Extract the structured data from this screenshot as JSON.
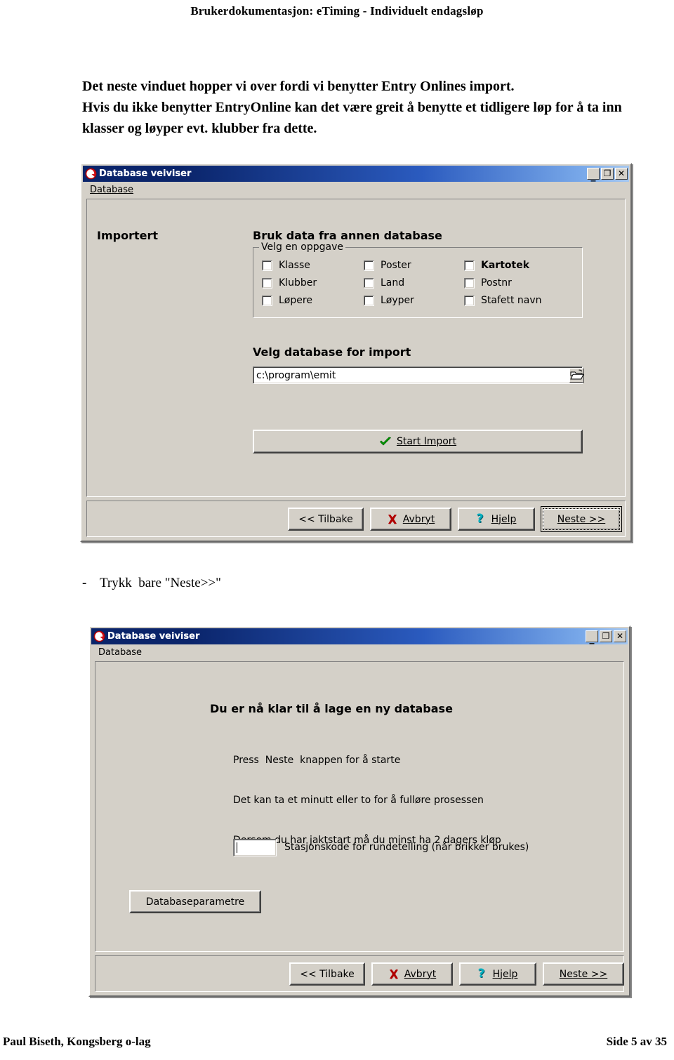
{
  "document": {
    "header": "Brukerdokumentasjon: eTiming - Individuelt endagsløp",
    "paragraph_line1": "Det neste vinduet hopper vi over fordi vi benytter Entry Onlines import.",
    "paragraph_line2": "Hvis du ikke benytter EntryOnline kan det være greit å benytte et tidligere løp for å ta inn",
    "paragraph_line3": "klasser og løyper evt. klubber fra dette.",
    "note": "-    Trykk  bare \"Neste>>\"",
    "footer_left": "Paul Biseth, Kongsberg o-lag",
    "footer_right": "Side 5 av 35"
  },
  "dialog1": {
    "title": "Database veiviser",
    "menu": {
      "database": "Database"
    },
    "window_buttons": {
      "minimize": "_",
      "maximize": "❐",
      "close": "✕"
    },
    "left_label": "Importert",
    "section_title": "Bruk data fra annen database",
    "groupbox_title": "Velg en oppgave",
    "checkboxes": [
      {
        "label": "Klasse",
        "checked": false,
        "bold": false
      },
      {
        "label": "Klubber",
        "checked": false,
        "bold": false
      },
      {
        "label": "Løpere",
        "checked": false,
        "bold": false
      },
      {
        "label": "Poster",
        "checked": false,
        "bold": false
      },
      {
        "label": "Land",
        "checked": false,
        "bold": false
      },
      {
        "label": "Løyper",
        "checked": false,
        "bold": false
      },
      {
        "label": "Kartotek",
        "checked": false,
        "bold": true
      },
      {
        "label": "Postnr",
        "checked": false,
        "bold": false
      },
      {
        "label": "Stafett navn",
        "checked": false,
        "bold": false
      }
    ],
    "db_label": "Velg database for import",
    "db_path_value": "c:\\program\\emit",
    "browse_icon": "folder-open-icon",
    "start_import_label": "Start Import",
    "start_import_icon": "green-check-icon",
    "buttons": {
      "back": "<< Tilbake",
      "cancel": "Avbryt",
      "help": "Hjelp",
      "next": "Neste >>"
    }
  },
  "dialog2": {
    "title": "Database veiviser",
    "menu": {
      "database": "Database"
    },
    "window_buttons": {
      "minimize": "_",
      "maximize": "❐",
      "close": "✕"
    },
    "heading": "Du er nå klar til å lage en ny database",
    "info_line1": "Press  Neste  knappen for å starte",
    "info_line2": "Det kan ta et minutt eller to for å fulløre prosessen",
    "info_line3": "Dersom du har jaktstart må du minst ha 2 dagers kløp",
    "station_code_value": "",
    "station_code_label": "Stasjonskode for rundetelling (når brikker brukes)",
    "db_params_label": "Databaseparametre",
    "buttons": {
      "back": "<< Tilbake",
      "cancel": "Avbryt",
      "help": "Hjelp",
      "next": "Neste >>"
    }
  },
  "colors": {
    "title_navy": "#0a246a",
    "title_light": "#a6c8f0",
    "window_face": "#d4d0c8",
    "check_green": "#00a000",
    "cancel_red": "#b00000",
    "help_cyan": "#00b0c0"
  }
}
